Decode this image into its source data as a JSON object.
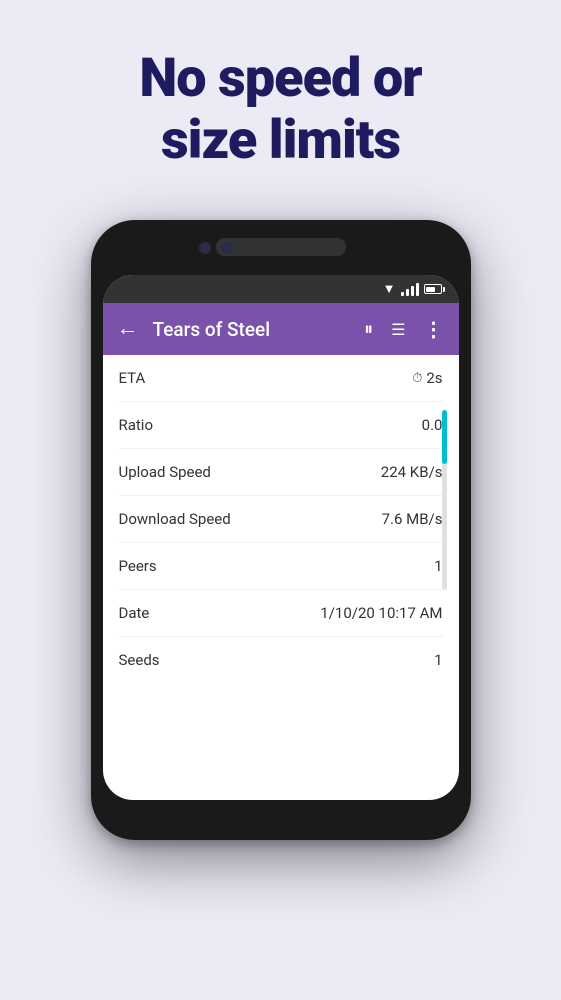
{
  "background_color": "#eceaf5",
  "headline": {
    "line1": "No speed or",
    "line2": "size limits"
  },
  "phone": {
    "status_bar": {
      "icons": [
        "wifi",
        "signal",
        "battery"
      ]
    },
    "app_bar": {
      "back_icon": "←",
      "title": "Tears of Steel",
      "pause_icon": "⏸",
      "list_icon": "☰",
      "more_icon": "⋮"
    },
    "rows": [
      {
        "label": "ETA",
        "value": "2s",
        "has_clock": true
      },
      {
        "label": "Ratio",
        "value": "0.0",
        "has_clock": false
      },
      {
        "label": "Upload Speed",
        "value": "224 KB/s",
        "has_clock": false
      },
      {
        "label": "Download Speed",
        "value": "7.6 MB/s",
        "has_clock": false
      },
      {
        "label": "Peers",
        "value": "1",
        "has_clock": false
      },
      {
        "label": "Date",
        "value": "1/10/20 10:17 AM",
        "has_clock": false
      },
      {
        "label": "Seeds",
        "value": "1",
        "has_clock": false
      }
    ],
    "colors": {
      "app_bar_bg": "#7b52ab",
      "progress_color": "#00bcd4"
    }
  }
}
